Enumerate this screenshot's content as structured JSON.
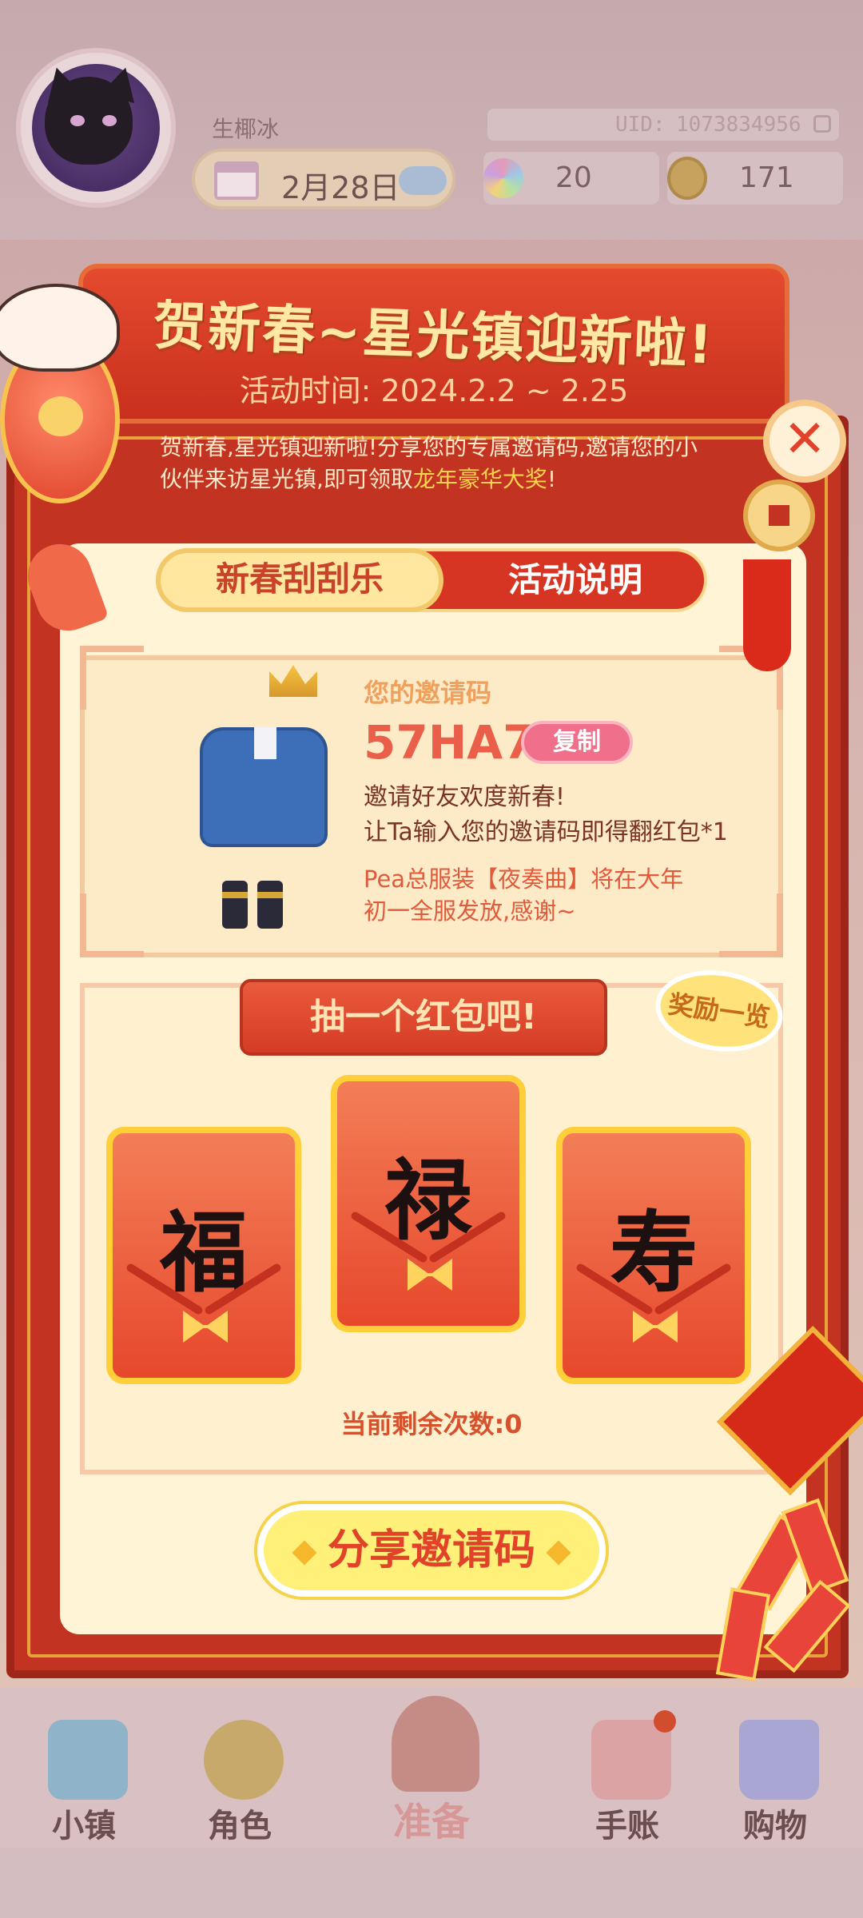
{
  "header": {
    "username": "生椰冰",
    "uid_label": "UID:",
    "uid_value": "1073834956",
    "date": "2月28日",
    "resource_flowers": "20",
    "resource_coins": "171"
  },
  "event": {
    "title": "贺新春~星光镇迎新啦!",
    "time": "活动时间: 2024.2.2 ~ 2.25",
    "intro_part1": "贺新春,星光镇迎新啦!分享您的专属邀请码,邀请您的小伙伴来访星光镇,即可领取",
    "intro_highlight": "龙年豪华大奖",
    "intro_part2": "!",
    "tabs": {
      "active": "新春刮刮乐",
      "inactive": "活动说明"
    },
    "invite": {
      "label": "您的邀请码",
      "code": "57HA7",
      "copy_label": "复制",
      "desc1": "邀请好友欢度新春!",
      "desc2": "让Ta输入您的邀请码即得翻红包*1",
      "note": "Pea总服装【夜奏曲】将在大年初一全服发放,感谢~"
    },
    "draw": {
      "title": "抽一个红包吧!",
      "rewards_label": "奖励一览",
      "envelopes": [
        "福",
        "禄",
        "寿"
      ],
      "remaining": "当前剩余次数:0"
    },
    "share_label": "分享邀请码",
    "close_label": "✕"
  },
  "nav": {
    "items": [
      "小镇",
      "角色",
      "准备",
      "手账",
      "购物"
    ]
  },
  "icons": {
    "avatar": "black-cat-avatar",
    "date": "calendar-icon",
    "weather": "cloud-icon",
    "flowers": "flower-icon",
    "coins": "coin-icon",
    "uid_copy": "copy-icon"
  },
  "colors": {
    "primary_red": "#c23421",
    "gold": "#ffcf3a",
    "cream": "#fff4d6",
    "code_red": "#ea5f4a"
  }
}
